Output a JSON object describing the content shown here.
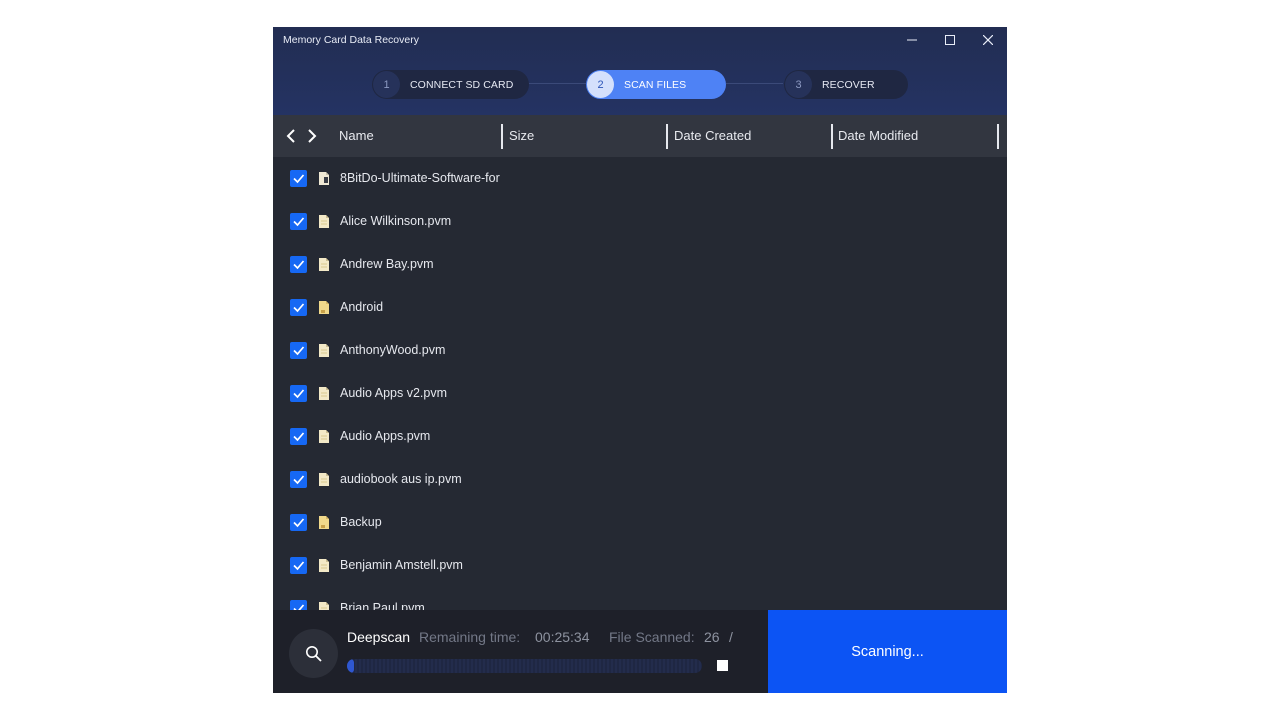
{
  "window": {
    "title": "Memory Card Data Recovery",
    "controls": {
      "minimize": "–",
      "maximize": "☐",
      "close": "✕"
    }
  },
  "steps": [
    {
      "number": "1",
      "label": "CONNECT SD CARD",
      "state": "inactive"
    },
    {
      "number": "2",
      "label": "SCAN FILES",
      "state": "active"
    },
    {
      "number": "3",
      "label": "RECOVER",
      "state": "inactive"
    }
  ],
  "columns": {
    "name": "Name",
    "size": "Size",
    "date_created": "Date Created",
    "date_modified": "Date Modified"
  },
  "files": [
    {
      "name": "8BitDo-Ultimate-Software-for",
      "type": "file-special",
      "checked": true
    },
    {
      "name": "Alice Wilkinson.pvm",
      "type": "file",
      "checked": true
    },
    {
      "name": "Andrew Bay.pvm",
      "type": "file",
      "checked": true
    },
    {
      "name": "Android",
      "type": "folder",
      "checked": true
    },
    {
      "name": "AnthonyWood.pvm",
      "type": "file",
      "checked": true
    },
    {
      "name": "Audio Apps v2.pvm",
      "type": "file",
      "checked": true
    },
    {
      "name": "Audio Apps.pvm",
      "type": "file",
      "checked": true
    },
    {
      "name": "audiobook aus ip.pvm",
      "type": "file",
      "checked": true
    },
    {
      "name": "Backup",
      "type": "folder",
      "checked": true
    },
    {
      "name": "Benjamin Amstell.pvm",
      "type": "file",
      "checked": true
    },
    {
      "name": "Brian Paul.pvm",
      "type": "file",
      "checked": true
    }
  ],
  "scan": {
    "mode": "Deepscan",
    "remaining_label": "Remaining time:",
    "remaining_value": "00:25:34",
    "scanned_label": "File Scanned:",
    "scanned_value": "26",
    "scanned_sep": "/",
    "progress": 0.02,
    "button_label": "Scanning..."
  },
  "colors": {
    "accent": "#0c54f4",
    "step_active": "#4e82f5",
    "checkbox": "#1668f4",
    "list_bg": "#252933",
    "header_bg": "#323640"
  },
  "icons": {
    "search": "search-icon",
    "back": "chevron-left-icon",
    "forward": "chevron-right-icon",
    "stop": "stop-icon",
    "file": "file-icon",
    "folder": "folder-icon",
    "check": "check-icon"
  }
}
